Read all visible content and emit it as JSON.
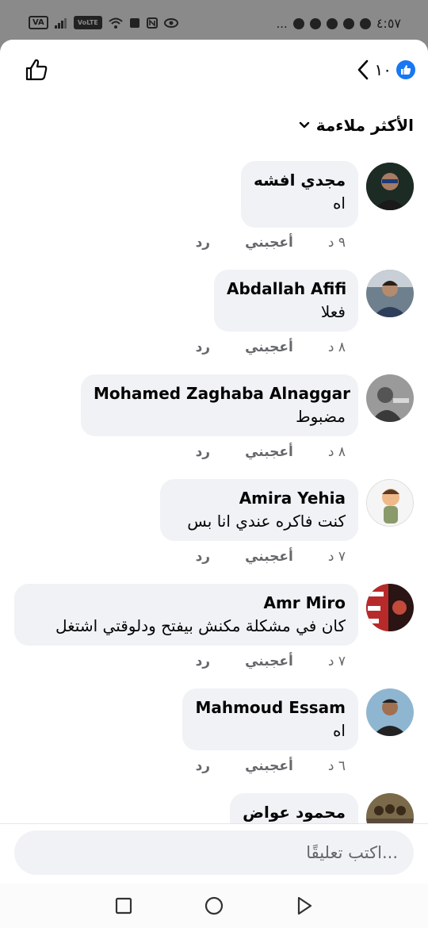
{
  "status_bar": {
    "time": "٤:٥٧",
    "left_badge": "VA",
    "volte": "VoLTE",
    "dots": "..."
  },
  "header": {
    "reaction_count": "١٠"
  },
  "sort": {
    "label": "الأكثر ملاءمة"
  },
  "comments": [
    {
      "name": "مجدي افشه",
      "text": "اه",
      "time": "٩ د",
      "like": "أعجبني",
      "reply": "رد"
    },
    {
      "name": "Abdallah Afifi",
      "text": "فعلا",
      "time": "٨ د",
      "like": "أعجبني",
      "reply": "رد"
    },
    {
      "name": "Mohamed Zaghaba Alnaggar",
      "text": "مضبوط",
      "time": "٨ د",
      "like": "أعجبني",
      "reply": "رد"
    },
    {
      "name": "Amira Yehia",
      "text": "كنت فاكره عندي انا بس",
      "time": "٧ د",
      "like": "أعجبني",
      "reply": "رد"
    },
    {
      "name": "Amr Miro",
      "text": "كان في مشكلة مكنش بيفتح ودلوقتي اشتغل",
      "time": "٧ د",
      "like": "أعجبني",
      "reply": "رد"
    },
    {
      "name": "Mahmoud Essam",
      "text": "اه",
      "time": "٦ د",
      "like": "أعجبني",
      "reply": "رد"
    },
    {
      "name": "محمود عواض",
      "text": "",
      "time": "",
      "like": "",
      "reply": ""
    }
  ],
  "composer": {
    "placeholder": "اكتب تعليقًا..."
  },
  "colors": {
    "accent": "#1877f2",
    "bubble": "#f0f2f5",
    "secondary_text": "#65676b"
  }
}
